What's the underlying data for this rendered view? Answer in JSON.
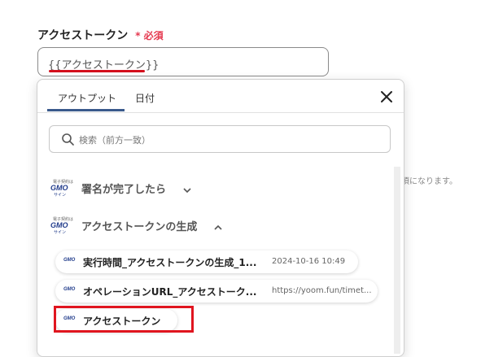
{
  "field": {
    "label": "アクセストークン",
    "required": "* 必須",
    "value": "{{アクセストークン}}",
    "hint": "須になります。"
  },
  "dropdown": {
    "tabs": [
      {
        "label": "アウトプット",
        "active": true
      },
      {
        "label": "日付",
        "active": false
      }
    ],
    "close_icon": "close-icon",
    "search": {
      "placeholder": "検索（前方一致）",
      "icon": "search-icon"
    },
    "logo": {
      "tagline": "電子契約は",
      "brand": "GMO",
      "sub": "サイン",
      "color": "#1f3a8a"
    },
    "groups": [
      {
        "title": "署名が完了したら",
        "expanded": false
      },
      {
        "title": "アクセストークンの生成",
        "expanded": true
      }
    ],
    "items": [
      {
        "name": "実行時間_アクセストークンの生成_1...",
        "value": "2024-10-16 10:49"
      },
      {
        "name": "オペレーションURL_アクセストーク...",
        "value": "https://yoom.fun/timet..."
      },
      {
        "name": "アクセストークン",
        "value": ""
      }
    ]
  },
  "colors": {
    "accent": "#3a5a8c",
    "highlight": "#e0151f",
    "required": "#e53950"
  }
}
